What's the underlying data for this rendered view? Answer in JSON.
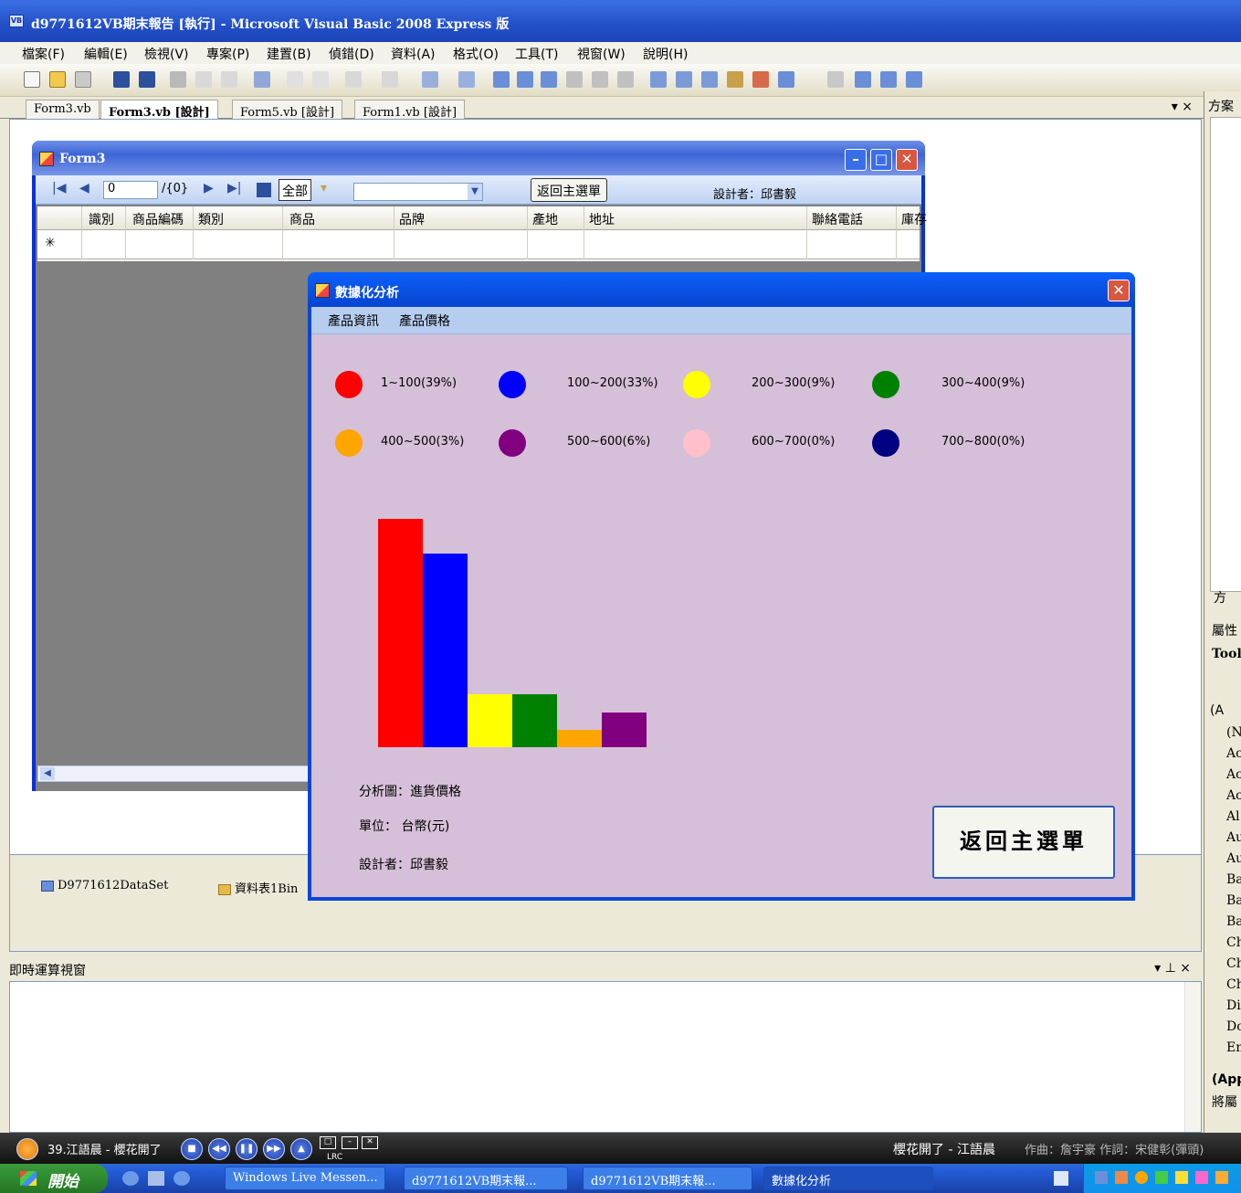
{
  "vs_window": {
    "title": "d9771612VB期末報告 [執行] - Microsoft Visual Basic 2008 Express 版",
    "menu": [
      "檔案(F)",
      "編輯(E)",
      "檢視(V)",
      "專案(P)",
      "建置(B)",
      "偵錯(D)",
      "資料(A)",
      "格式(O)",
      "工具(T)",
      "視窗(W)",
      "說明(H)"
    ],
    "tabs": [
      "Form3.vb",
      "Form3.vb [設計]",
      "Form5.vb [設計]",
      "Form1.vb [設計]"
    ],
    "tab_controls": "▾ ×"
  },
  "form3": {
    "title": "Form3",
    "navigator": {
      "position": "0",
      "count": "/{0}",
      "all_label": "全部",
      "back_label": "返回主選單",
      "designer": "設計者：邱書毅"
    },
    "grid_columns": [
      "識別",
      "商品編碼",
      "類別",
      "商品",
      "品牌",
      "產地",
      "地址",
      "聯絡電話",
      "庫存"
    ],
    "new_row_marker": "✳"
  },
  "component_tray": {
    "items": [
      "D9771612DataSet",
      "資料表1Bin"
    ]
  },
  "analysis_window": {
    "title": "數據化分析",
    "menu": [
      "產品資訊",
      "產品價格"
    ],
    "legend": [
      {
        "label": "1~100(39%)",
        "color": "#ff0000"
      },
      {
        "label": "100~200(33%)",
        "color": "#0000ff"
      },
      {
        "label": "200~300(9%)",
        "color": "#ffff00"
      },
      {
        "label": "300~400(9%)",
        "color": "#008000"
      },
      {
        "label": "400~500(3%)",
        "color": "#ffa500"
      },
      {
        "label": "500~600(6%)",
        "color": "#800080"
      },
      {
        "label": "600~700(0%)",
        "color": "#ffc0cb"
      },
      {
        "label": "700~800(0%)",
        "color": "#000080"
      }
    ],
    "info": {
      "chart_label": "分析圖：進貨價格",
      "unit": "單位： 台幣(元)",
      "designer": "設計者：邱書毅"
    },
    "back_button": "返回主選單"
  },
  "chart_data": {
    "type": "bar",
    "categories": [
      "1~100",
      "100~200",
      "200~300",
      "300~400",
      "400~500",
      "500~600",
      "600~700",
      "700~800"
    ],
    "values": [
      39,
      33,
      9,
      9,
      3,
      6,
      0,
      0
    ],
    "colors": [
      "#ff0000",
      "#0000ff",
      "#ffff00",
      "#008000",
      "#ffa500",
      "#800080",
      "#ffc0cb",
      "#000080"
    ],
    "title": "",
    "xlabel": "",
    "ylabel": "",
    "ylim": [
      0,
      39
    ],
    "grid": false
  },
  "immediate_window": {
    "title": "即時運算視窗",
    "controls": "▾ ⊥ ×"
  },
  "right_panel": {
    "solution_tab": "方案",
    "solution_tab2": "方",
    "properties_tab": "屬性",
    "properties_object": "Tool",
    "properties_group": "(A",
    "properties_rows": [
      "(N",
      "Ac",
      "Ac",
      "Ac",
      "Al",
      "Au",
      "Au",
      "Ba",
      "Ba",
      "Ba",
      "Ch",
      "Ch",
      "Ch",
      "Di",
      "Do",
      "En"
    ],
    "desc_title": "(App",
    "desc_text": "將屬"
  },
  "media_bar": {
    "song": "39.江語晨 - 櫻花開了",
    "now_playing": "櫻花開了 - 江語晨",
    "credits": "作曲：詹宇豪 作詞：宋健彰(彈頭)",
    "lrc_label": "LRC"
  },
  "taskbar": {
    "start": "開始",
    "tasks": [
      "Windows Live Messen...",
      "d9771612VB期末報...",
      "d9771612VB期末報...",
      "數據化分析"
    ]
  }
}
